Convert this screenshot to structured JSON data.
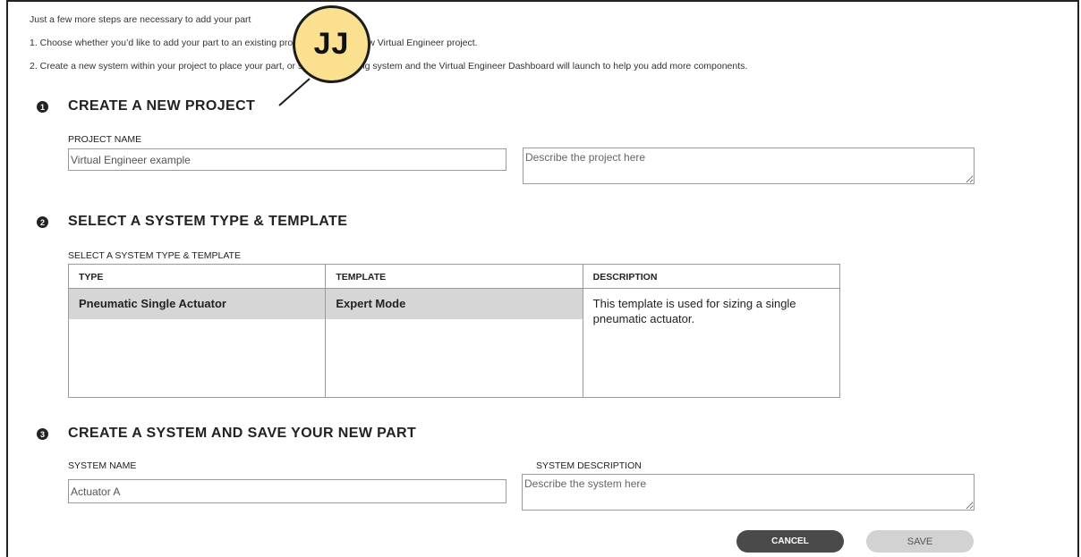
{
  "intro": {
    "line0": "Just a few more steps are necessary to add your part",
    "line1": "1. Choose whether you’d like to add your part to an existing project or create a new Virtual Engineer project.",
    "line2": "2. Create a new system within your project to place your part, or select an existing system and the Virtual Engineer Dashboard will launch to help you add more components."
  },
  "callout": {
    "text": "JJ",
    "color": "#fbe08f"
  },
  "section1": {
    "number": "1",
    "heading": "CREATE A NEW PROJECT",
    "project_name_label": "PROJECT NAME",
    "project_name_value": "Virtual Engineer example",
    "project_description_placeholder": "Describe the project here"
  },
  "section2": {
    "number": "2",
    "heading": "SELECT A SYSTEM TYPE & TEMPLATE",
    "table_label": "SELECT A SYSTEM TYPE & TEMPLATE",
    "columns": [
      "TYPE",
      "TEMPLATE",
      "DESCRIPTION"
    ],
    "selected_row": {
      "type": "Pneumatic Single Actuator",
      "template": "Expert Mode",
      "description": "This template is used for sizing a single pneumatic actuator."
    }
  },
  "section3": {
    "number": "3",
    "heading": "CREATE A SYSTEM AND SAVE YOUR NEW PART",
    "system_name_label": "SYSTEM NAME",
    "system_name_value": "Actuator A",
    "system_description_label": "SYSTEM DESCRIPTION",
    "system_description_placeholder": "Describe the system here"
  },
  "buttons": {
    "cancel": "CANCEL",
    "save": "SAVE"
  },
  "colors": {
    "selected_row": "#d6d6d6",
    "cancel_button": "#4a4a4a",
    "save_button": "#d2d2d2"
  }
}
